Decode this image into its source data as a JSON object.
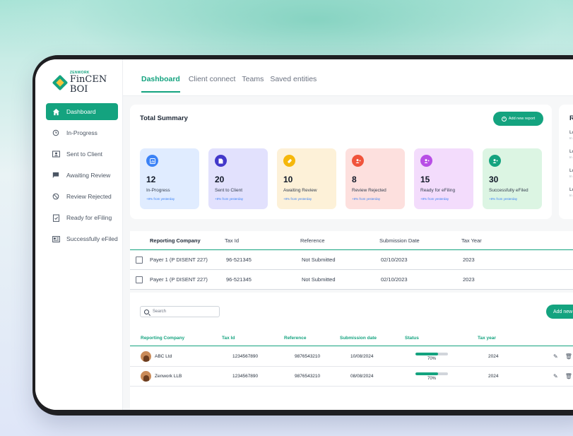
{
  "brand": {
    "small": "ZENWORK",
    "name": "FinCEN BOI"
  },
  "tabs": [
    {
      "label": "Dashboard",
      "active": true
    },
    {
      "label": "Client connect"
    },
    {
      "label": "Teams"
    },
    {
      "label": "Saved entities"
    }
  ],
  "sidebar": {
    "items": [
      {
        "label": "Dashboard",
        "icon": "home-icon",
        "active": true
      },
      {
        "label": "In-Progress",
        "icon": "clock-icon"
      },
      {
        "label": "Sent to Client",
        "icon": "user-card-icon"
      },
      {
        "label": "Awaiting Review",
        "icon": "flag-icon"
      },
      {
        "label": "Review Rejected",
        "icon": "ban-icon"
      },
      {
        "label": "Ready for eFiling",
        "icon": "check-clipboard-icon"
      },
      {
        "label": "Successfully eFiled",
        "icon": "id-card-icon"
      }
    ]
  },
  "summary": {
    "title": "Total Summary",
    "add_button": "Add new report",
    "cards": [
      {
        "value": "12",
        "label": "In-Progress",
        "sub": "+8% from yesterday",
        "bg": "#e0ecff",
        "icon_bg": "#3b82f6",
        "icon": "chart-icon"
      },
      {
        "value": "20",
        "label": "Sent to Client",
        "sub": "+8% from yesterday",
        "bg": "#e2e1fd",
        "icon_bg": "#4338ca",
        "icon": "document-icon"
      },
      {
        "value": "10",
        "label": "Awaiting Review",
        "sub": "+8% from yesterday",
        "bg": "#fdf1d8",
        "icon_bg": "#f5b70b",
        "icon": "tag-icon"
      },
      {
        "value": "8",
        "label": "Review Rejected",
        "sub": "+8% from yesterday",
        "bg": "#fde0de",
        "icon_bg": "#f0543c",
        "icon": "users-icon"
      },
      {
        "value": "15",
        "label": "Ready for eFiling",
        "sub": "+8% from yesterday",
        "bg": "#f3dcfc",
        "icon_bg": "#b84ee6",
        "icon": "users-icon"
      },
      {
        "value": "30",
        "label": "Successfully eFiled",
        "sub": "+8% from yesterday",
        "bg": "#dcf5e3",
        "icon_bg": "#14a37f",
        "icon": "users-icon"
      }
    ]
  },
  "side_panel": {
    "title": "R",
    "rows": [
      {
        "a": "Lo",
        "b": "In"
      },
      {
        "a": "Lo",
        "b": "In"
      },
      {
        "a": "Lo",
        "b": "In"
      },
      {
        "a": "Lo",
        "b": "In"
      }
    ]
  },
  "table1": {
    "headers": [
      "Reporting Company",
      "Tax Id",
      "Reference",
      "Submission Date",
      "Tax Year"
    ],
    "rows": [
      [
        "Payer 1 (P DISENT 227)",
        "96-521345",
        "Not Submitted",
        "02/10/2023",
        "2023"
      ],
      [
        "Payer 1 (P DISENT 227)",
        "96-521345",
        "Not Submitted",
        "02/10/2023",
        "2023"
      ]
    ]
  },
  "table2": {
    "search_placeholder": "Search",
    "add_button": "Add new",
    "headers": [
      "Reporting Company",
      "Tax Id",
      "Reference",
      "Submission date",
      "Status",
      "Tax year"
    ],
    "rows": [
      {
        "company": "ABC Ltd",
        "tax_id": "1234567890",
        "reference": "9876543210",
        "date": "10/08/2024",
        "progress": 0.7,
        "progress_label": "70%",
        "year": "2024"
      },
      {
        "company": "Zenwork LLB",
        "tax_id": "1234567890",
        "reference": "9876543210",
        "date": "08/08/2024",
        "progress": 0.7,
        "progress_label": "70%",
        "year": "2024"
      }
    ]
  },
  "colors": {
    "accent": "#14a37f"
  }
}
